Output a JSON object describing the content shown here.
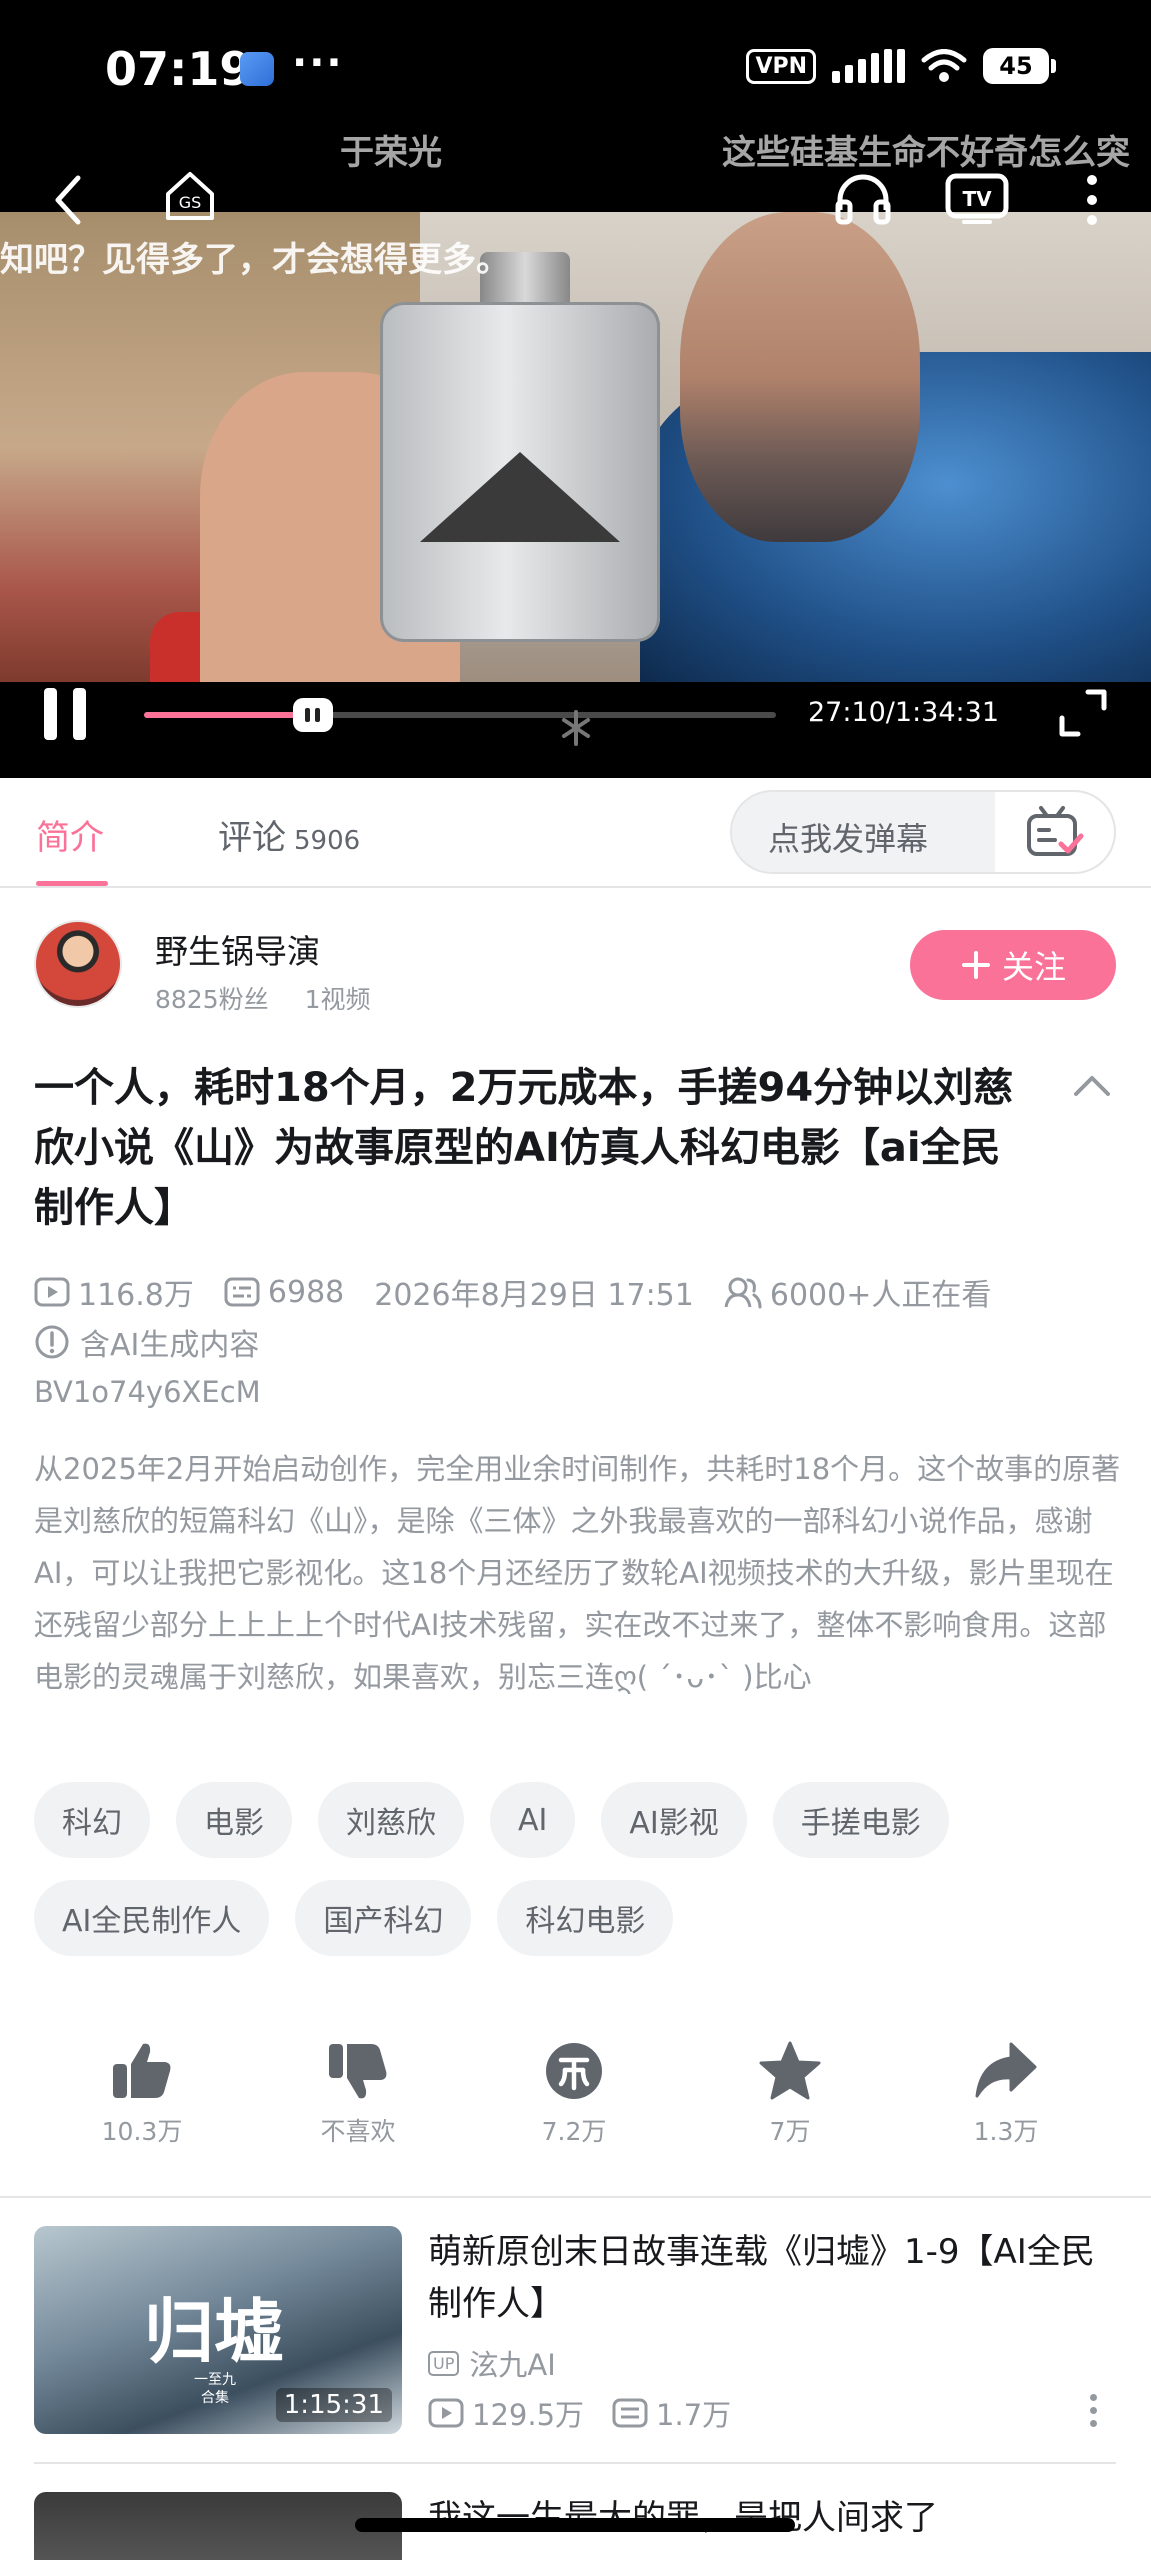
{
  "status_bar": {
    "time": "07:19",
    "dots": "···",
    "vpn": "VPN",
    "battery": "45"
  },
  "danmaku": [
    "于荣光",
    "这些硅基生命不好奇怎么突",
    "知吧？见得多了，才会想得更多。"
  ],
  "player": {
    "time_code": "27:10/1:34:31",
    "progress": 0.267
  },
  "tabs": {
    "intro": "简介",
    "comments": "评论",
    "comment_count": "5906",
    "danmaku_placeholder": "点我发弹幕"
  },
  "uploader": {
    "name": "野生锅导演",
    "fans": "8825粉丝",
    "videos": "1视频",
    "follow": "关注"
  },
  "video": {
    "title": "一个人，耗时18个月，2万元成本，手搓94分钟以刘慈欣小说《山》为故事原型的AI仿真人科幻电影【ai全民制作人】",
    "views": "116.8万",
    "danmaku": "6988",
    "date": "2026年8月29日 17:51",
    "watching": "6000+人正在看",
    "ai_note": "含AI生成内容",
    "bvid": "BV1o74y6XEcM",
    "description": "从2025年2月开始启动创作，完全用业余时间制作，共耗时18个月。这个故事的原著是刘慈欣的短篇科幻《山》，是除《三体》之外我最喜欢的一部科幻小说作品，感谢AI，可以让我把它影视化。这18个月还经历了数轮AI视频技术的大升级，影片里现在还残留少部分上上上上个时代AI技术残留，实在改不过来了，整体不影响食用。这部电影的灵魂属于刘慈欣，如果喜欢，别忘三连ღ( ´･ᴗ･` )比心"
  },
  "tags": [
    "科幻",
    "电影",
    "刘慈欣",
    "AI",
    "AI影视",
    "手搓电影",
    "AI全民制作人",
    "国产科幻",
    "科幻电影"
  ],
  "actions": {
    "like": "10.3万",
    "dislike": "不喜欢",
    "coin": "7.2万",
    "favorite": "7万",
    "share": "1.3万"
  },
  "recommend": {
    "thumb_text": "归墟",
    "thumb_sub": "一至九\n合集",
    "duration": "1:15:31",
    "title": "萌新原创末日故事连载《归墟》1-9【AI全民制作人】",
    "up_badge": "UP",
    "up_name": "泫九AI",
    "views": "129.5万",
    "danmaku": "1.7万",
    "next_title": "我这一生最大的罪，是把人间求了"
  },
  "colors": {
    "accent": "#fb7299",
    "text_gray": "#9499a0"
  }
}
